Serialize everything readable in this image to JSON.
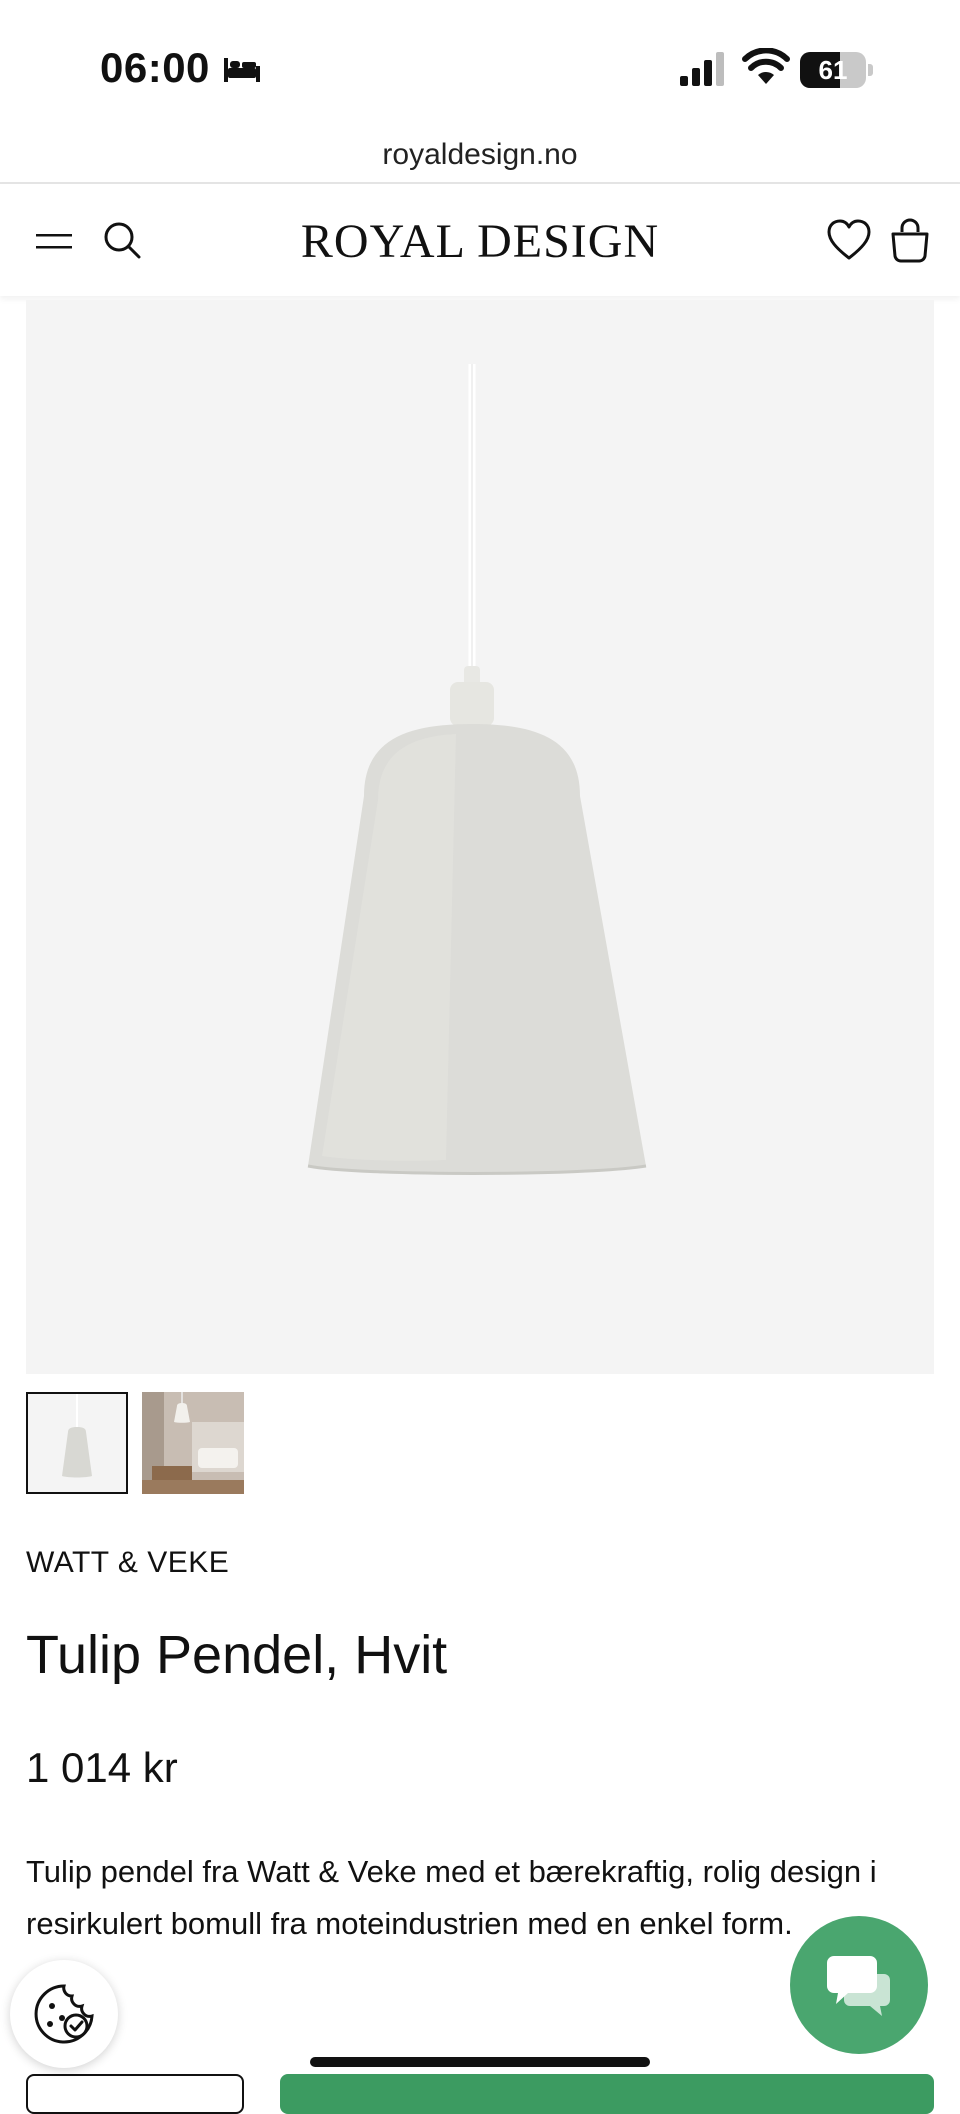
{
  "status_bar": {
    "time": "06:00",
    "battery": "61",
    "battery_level": 0.61
  },
  "browser": {
    "url": "royaldesign.no"
  },
  "header": {
    "logo": "ROYAL DESIGN",
    "icons": [
      "menu-icon",
      "search-icon",
      "heart-icon",
      "bag-icon"
    ]
  },
  "product": {
    "brand": "WATT & VEKE",
    "title": "Tulip Pendel, Hvit",
    "price": "1 014 kr",
    "description": "Tulip pendel fra Watt & Veke med et bærekraftig, rolig design i resirkulert bomull fra moteindustrien med en enkel form."
  },
  "colors": {
    "accent_green": "#4aa66f",
    "cta_green": "#3c9b61",
    "image_bg": "#f4f4f4"
  }
}
